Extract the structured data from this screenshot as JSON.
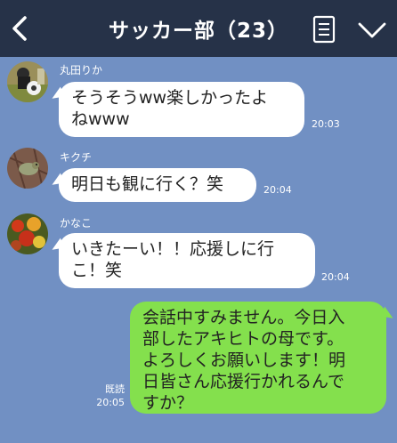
{
  "header": {
    "title": "サッカー部（23）",
    "background_color": "#263248"
  },
  "chat": {
    "background_color": "#7190c3",
    "messages": [
      {
        "sender": "丸田りか",
        "lines": [
          "そうそうww楽しかったよ",
          "ねwww"
        ],
        "time": "20:03",
        "avatar": "soccer-ball-photo"
      },
      {
        "sender": "キクチ",
        "lines": [
          "明日も観に行く？笑"
        ],
        "time": "20:04",
        "avatar": "bird-photo"
      },
      {
        "sender": "かなこ",
        "lines": [
          "いきたーい！！応援しに行",
          "こ！笑"
        ],
        "time": "20:04",
        "avatar": "flowers-photo"
      }
    ],
    "sent_message": {
      "lines": [
        "会話中すみません。今日入",
        "部したアキヒトの母です。",
        "よろしくお願いします！明",
        "日皆さん応援行かれるんで",
        "すか？"
      ],
      "read_label": "既読",
      "time": "20:05",
      "bubble_color": "#84e04d"
    }
  }
}
